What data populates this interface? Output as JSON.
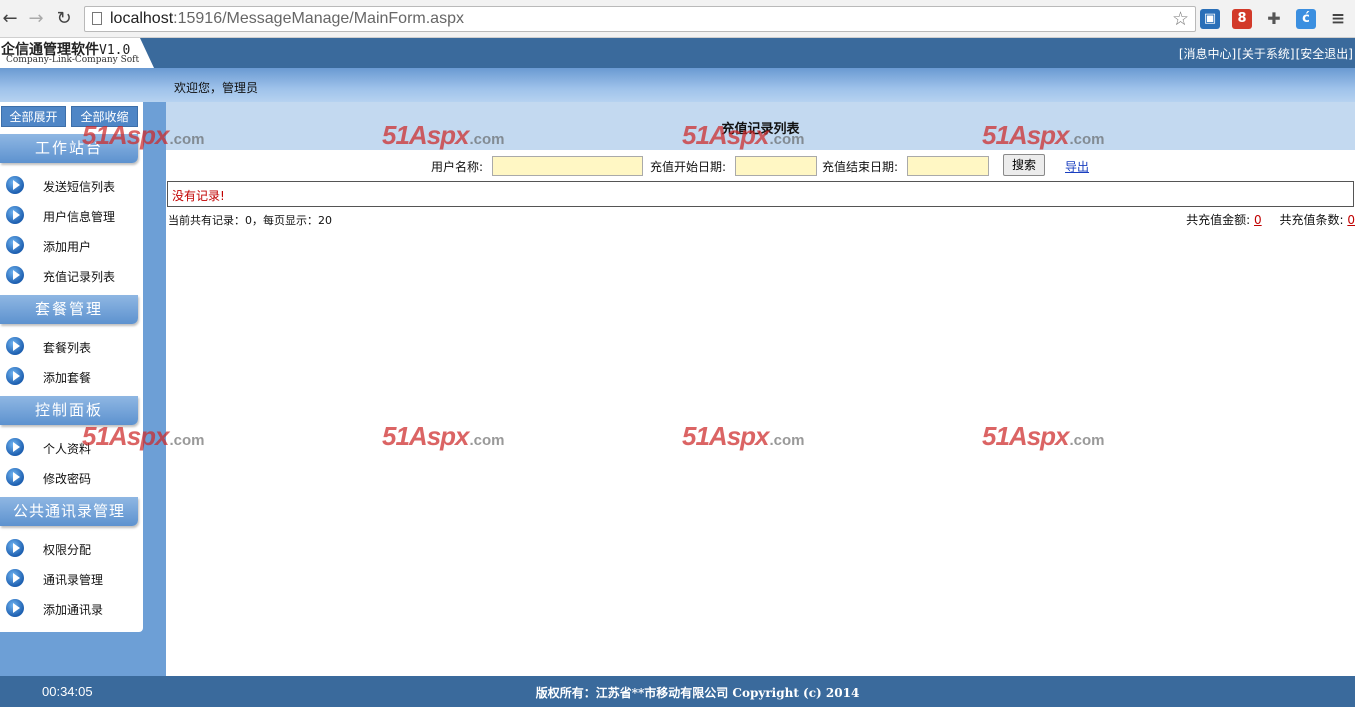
{
  "browser": {
    "url_host": "localhost",
    "url_rest": ":15916/MessageManage/MainForm.aspx"
  },
  "app": {
    "logo_title": "企信通管理软件",
    "logo_version": "V1.0",
    "logo_subtitle": "Company-Link-Company Soft",
    "top_links": [
      "[消息中心]",
      "[关于系统]",
      "[安全退出]"
    ],
    "welcome": "欢迎您，管理员"
  },
  "sidebar": {
    "expand_all": "全部展开",
    "collapse_all": "全部收缩",
    "groups": [
      {
        "title": "工作站台",
        "items": [
          "发送短信列表",
          "用户信息管理",
          "添加用户",
          "充值记录列表"
        ]
      },
      {
        "title": "套餐管理",
        "items": [
          "套餐列表",
          "添加套餐"
        ]
      },
      {
        "title": "控制面板",
        "items": [
          "个人资料",
          "修改密码"
        ]
      },
      {
        "title": "公共通讯录管理",
        "items": [
          "权限分配",
          "通讯录管理",
          "添加通讯录"
        ]
      }
    ]
  },
  "main": {
    "title": "充值记录列表",
    "search": {
      "username_label": "用户名称:",
      "start_label": "充值开始日期:",
      "end_label": "充值结束日期:",
      "search_button": "搜索",
      "export_link": "导出"
    },
    "no_record": "没有记录!",
    "count_info": "当前共有记录：0，每页显示：20",
    "total_amount_label": "共充值金额:",
    "total_amount": "0",
    "total_count_label": "共充值条数:",
    "total_count": "0"
  },
  "watermark": {
    "big": "51Aspx",
    "small": ".com"
  },
  "footer": {
    "clock": "00:34:05",
    "copyright": "版权所有：江苏省**市移动有限公司 Copyright (c) 2014"
  },
  "colors": {
    "header_bg": "#3a6a9c",
    "sidebar_frame": "#6d9fd6",
    "title_band": "#c3d9f0",
    "input_bg": "#fff7c4",
    "alert_red": "#c00000"
  }
}
